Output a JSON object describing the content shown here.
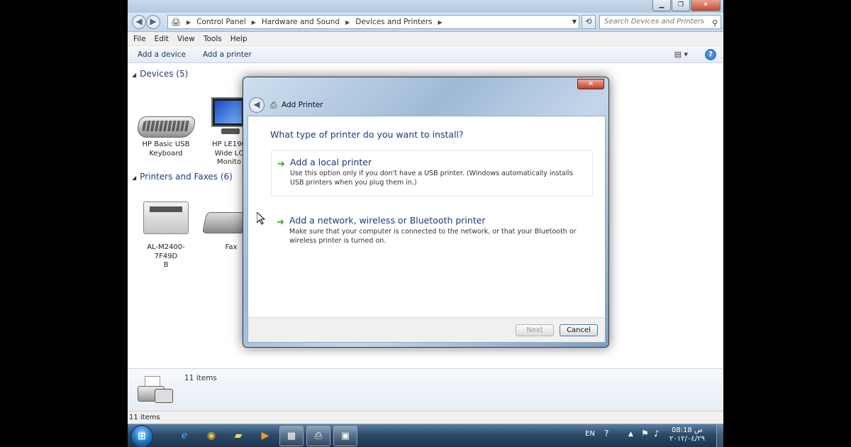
{
  "window": {
    "controls": {
      "minimize": "▁",
      "maximize": "❐",
      "close": "✕"
    }
  },
  "address": {
    "back": "◀",
    "forward": "▶",
    "crumbs": [
      "Control Panel",
      "Hardware and Sound",
      "Devices and Printers"
    ],
    "refresh": "⟲",
    "search_placeholder": "Search Devices and Printers"
  },
  "menu": [
    "File",
    "Edit",
    "View",
    "Tools",
    "Help"
  ],
  "commands": {
    "add_device": "Add a device",
    "add_printer": "Add a printer",
    "help": "?"
  },
  "devices": {
    "header": "Devices (5)",
    "items": [
      {
        "label_line1": "HP Basic USB",
        "label_line2": "Keyboard"
      },
      {
        "label_line1": "HP LE190",
        "label_line2": "Wide LC",
        "label_line3": "Monito"
      }
    ]
  },
  "printers": {
    "header": "Printers and Faxes (6)",
    "items": [
      {
        "label_line1": "AL-M2400-7F49D",
        "label_line2": "B"
      },
      {
        "label_line1": "Fax"
      }
    ]
  },
  "details": {
    "count": "11 items"
  },
  "statusbar": {
    "text": "11 items"
  },
  "taskbar": {
    "start": "⊞",
    "language": "EN",
    "time": "08:18 ص",
    "date": "٢٠١٢/٠٤/٢٩"
  },
  "dialog": {
    "close": "✕",
    "back": "◀",
    "title": "Add Printer",
    "question": "What type of printer do you want to install?",
    "options": [
      {
        "title": "Add a local printer",
        "description": "Use this option only if you don't have a USB printer. (Windows automatically installs USB printers when you plug them in.)"
      },
      {
        "title": "Add a network, wireless or Bluetooth printer",
        "description": "Make sure that your computer is connected to the network, or that your Bluetooth or wireless printer is turned on."
      }
    ],
    "next": "Next",
    "cancel": "Cancel"
  },
  "colors": {
    "link": "#1a3b7a",
    "option_arrow": "#2aa52a",
    "taskbar": "#2c4a69"
  }
}
